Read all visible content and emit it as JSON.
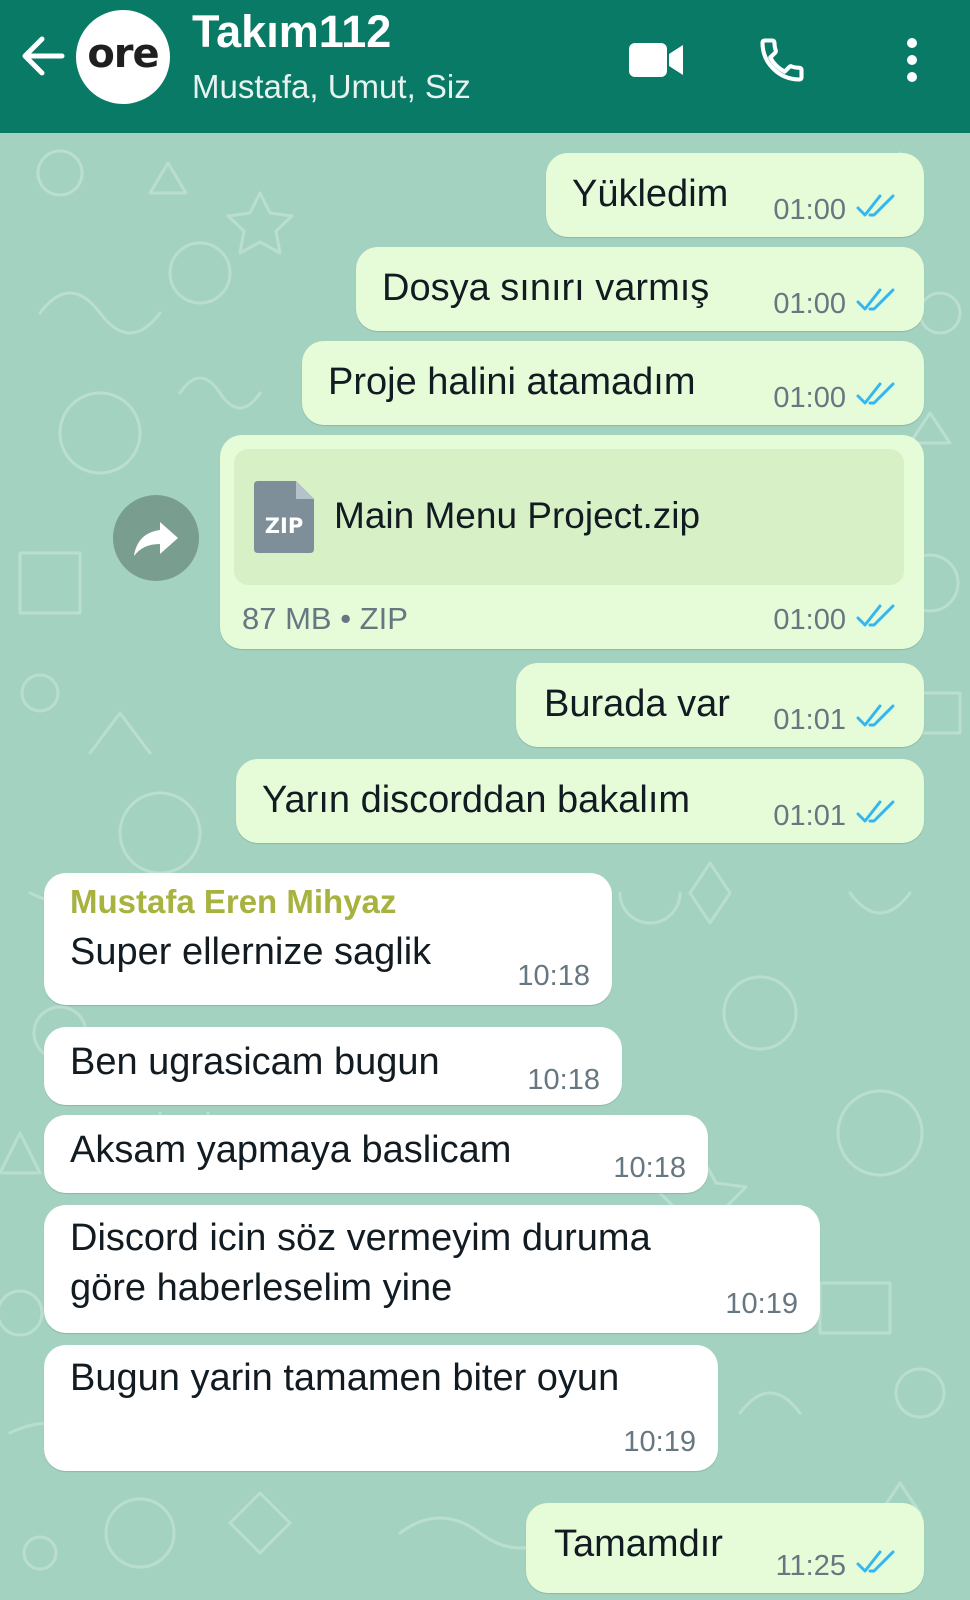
{
  "header": {
    "title": "Takım112",
    "subtitle": "Mustafa, Umut, Siz",
    "avatar_text": "ore",
    "bg_color": "#087a66",
    "icons": [
      "back-arrow-icon",
      "video-call-icon",
      "voice-call-icon",
      "more-options-icon"
    ]
  },
  "theme": {
    "chat_bg": "#a4d2c0",
    "outgoing_bubble": "#e6fcd8",
    "incoming_bubble": "#ffffff",
    "read_tick": "#34b7f1",
    "sender_color": "#a7b23f"
  },
  "messages": [
    {
      "text": "Yükledim",
      "time": "01:00"
    },
    {
      "text": "Dosya sınırı varmış",
      "time": "01:00"
    },
    {
      "text": "Proje halini atamadım",
      "time": "01:00"
    },
    {
      "file_badge": "ZIP",
      "file_name": "Main Menu Project.zip",
      "file_info": "87 MB • ZIP",
      "time": "01:00"
    },
    {
      "text": "Burada var",
      "time": "01:01"
    },
    {
      "text": "Yarın discorddan bakalım",
      "time": "01:01"
    },
    {
      "sender": "Mustafa Eren Mihyaz",
      "text": "Super ellernize saglik",
      "time": "10:18"
    },
    {
      "text": "Ben ugrasicam bugun",
      "time": "10:18"
    },
    {
      "text": "Aksam yapmaya baslicam",
      "time": "10:18"
    },
    {
      "text_line1": "Discord icin söz vermeyim duruma",
      "text_line2": "göre haberleselim yine",
      "time": "10:19"
    },
    {
      "text": "Bugun yarin tamamen biter oyun",
      "time": "10:19"
    },
    {
      "text": "Tamamdır",
      "time": "11:25"
    }
  ]
}
